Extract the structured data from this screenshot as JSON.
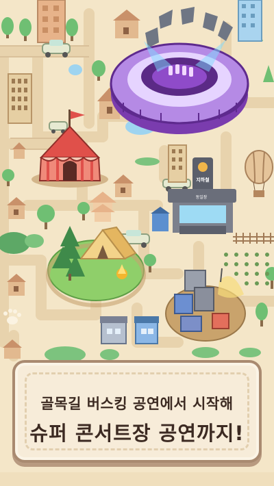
{
  "banner": {
    "line1": "골목길 버스킹 공연에서 시작해",
    "line2": "슈퍼 콘서트장 공연까지!"
  },
  "map": {
    "landmarks": {
      "subway_sign": "지하철",
      "subway_plate": "동일장"
    }
  },
  "colors": {
    "background": "#f4e6c8",
    "road": "#e9d6b1",
    "stadium": "#9a5cd6",
    "banner_border": "#a98a70",
    "banner_fill": "#f7ecd9",
    "text": "#3c2a22"
  }
}
